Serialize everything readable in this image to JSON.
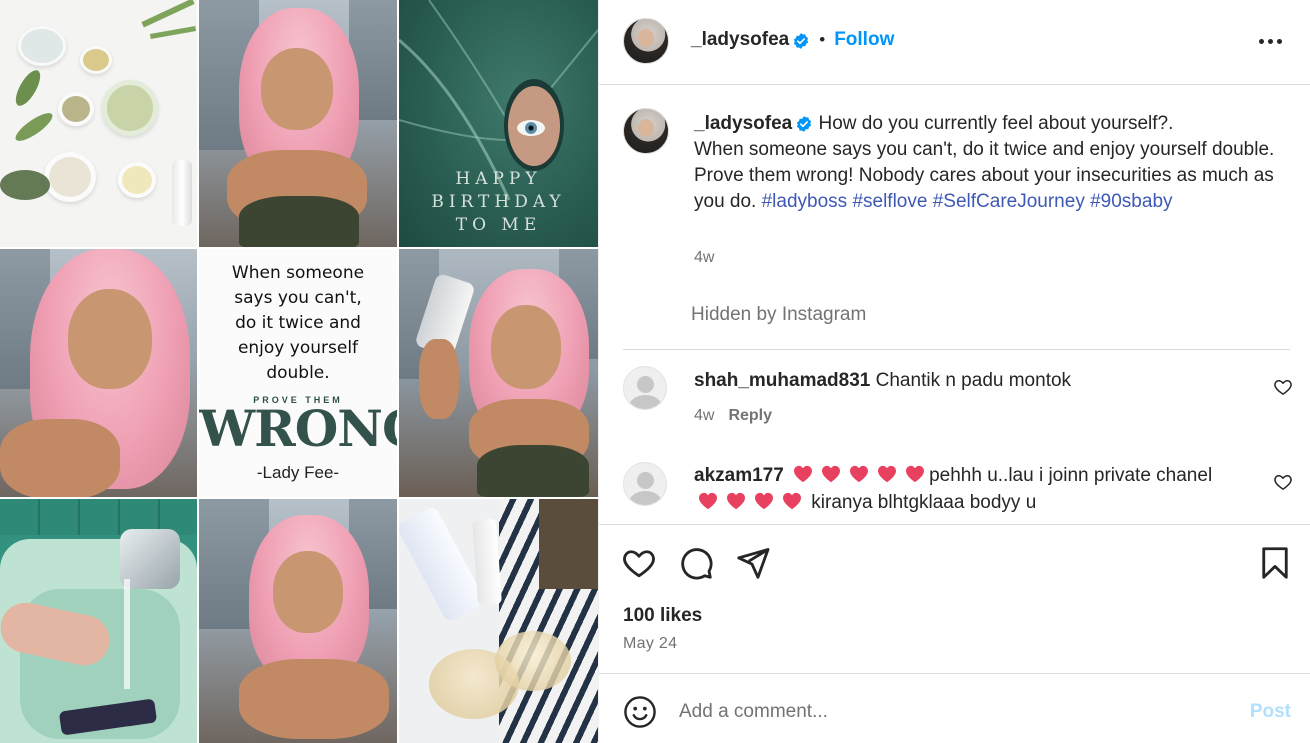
{
  "post": {
    "username": "_ladysofea",
    "verified": true,
    "follow_label": "Follow",
    "separator": "•",
    "caption": {
      "username": "_ladysofea",
      "text_line1": "How do you currently feel about yourself?.",
      "text_rest": "When someone says you can't, do it twice and enjoy yourself double. Prove them wrong! Nobody cares about your insecurities as much as you do.",
      "hashtags": [
        "#ladyboss",
        "#selflove",
        "#SelfCareJourney",
        "#90sbaby"
      ],
      "age": "4w"
    },
    "hidden_notice": "Hidden by Instagram",
    "comments": [
      {
        "username": "shah_muhamad831",
        "text": "Chantik n padu montok",
        "age": "4w",
        "reply_label": "Reply"
      },
      {
        "username": "akzam177",
        "text_a": "pehhh u..lau i joinn private chanel",
        "text_b": "kiranya blhtgklaaa bodyy u"
      }
    ],
    "likes": "100 likes",
    "date": "May 24",
    "comment_placeholder": "Add a comment...",
    "post_label": "Post"
  },
  "media": {
    "quote": {
      "lines": [
        "When someone",
        "says you can't,",
        "do it twice and",
        "enjoy yourself",
        "double."
      ],
      "small": "PROVE THEM",
      "big": "WRONG",
      "signature": "-Lady Fee-"
    },
    "birthday": [
      "HAPPY",
      "BIRTHDAY",
      "TO ME"
    ]
  },
  "icons": [
    "verified-badge-icon",
    "more-options-icon",
    "heart-icon",
    "comment-icon",
    "share-icon",
    "bookmark-icon",
    "emoji-icon",
    "default-avatar-icon"
  ],
  "colors": {
    "accent": "#0095f6",
    "hashtag": "#3e58b6",
    "muted": "#737373",
    "heart_emoji": "#e8415f"
  }
}
